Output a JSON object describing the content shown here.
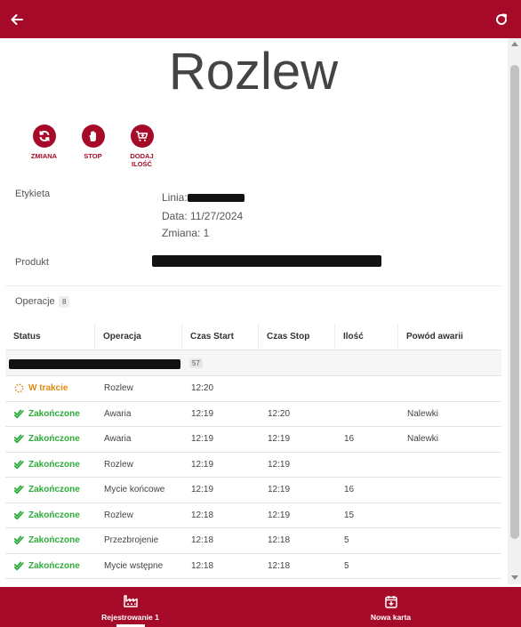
{
  "page": {
    "title": "Rozlew"
  },
  "actions": [
    {
      "label": "ZMIANA",
      "icon": "refresh-icon"
    },
    {
      "label": "STOP",
      "icon": "hand-icon"
    },
    {
      "label": "DODAJ ILOŚĆ",
      "icon": "add-cart-icon"
    }
  ],
  "info": {
    "etykieta_label": "Etykieta",
    "linia_label": "Linia:",
    "data_line": "Data: 11/27/2024",
    "zmiana_line": "Zmiana: 1",
    "produkt_label": "Produkt"
  },
  "operations": {
    "title": "Operacje",
    "count": "8",
    "group_count": "57",
    "columns": [
      "Status",
      "Operacja",
      "Czas Start",
      "Czas Stop",
      "Ilość",
      "Powód awarii"
    ],
    "rows": [
      {
        "status": "W trakcie",
        "state": "progress",
        "operation": "Rozlew",
        "start": "12:20",
        "stop": "",
        "qty": "",
        "reason": ""
      },
      {
        "status": "Zakończone",
        "state": "done",
        "operation": "Awaria",
        "start": "12:19",
        "stop": "12:20",
        "qty": "",
        "reason": "Nalewki"
      },
      {
        "status": "Zakończone",
        "state": "done",
        "operation": "Awaria",
        "start": "12:19",
        "stop": "12:19",
        "qty": "16",
        "reason": "Nalewki"
      },
      {
        "status": "Zakończone",
        "state": "done",
        "operation": "Rozlew",
        "start": "12:19",
        "stop": "12:19",
        "qty": "",
        "reason": ""
      },
      {
        "status": "Zakończone",
        "state": "done",
        "operation": "Mycie końcowe",
        "start": "12:19",
        "stop": "12:19",
        "qty": "16",
        "reason": ""
      },
      {
        "status": "Zakończone",
        "state": "done",
        "operation": "Rozlew",
        "start": "12:18",
        "stop": "12:19",
        "qty": "15",
        "reason": ""
      },
      {
        "status": "Zakończone",
        "state": "done",
        "operation": "Przezbrojenie",
        "start": "12:18",
        "stop": "12:18",
        "qty": "5",
        "reason": ""
      },
      {
        "status": "Zakończone",
        "state": "done",
        "operation": "Mycie wstępne",
        "start": "12:18",
        "stop": "12:18",
        "qty": "5",
        "reason": ""
      }
    ]
  },
  "bottom_nav": {
    "tab1": "Rejestrowanie 1",
    "tab2": "Nowa karta"
  },
  "colors": {
    "brand": "#a50b28",
    "done": "#2cab3a",
    "progress": "#e08a12"
  }
}
